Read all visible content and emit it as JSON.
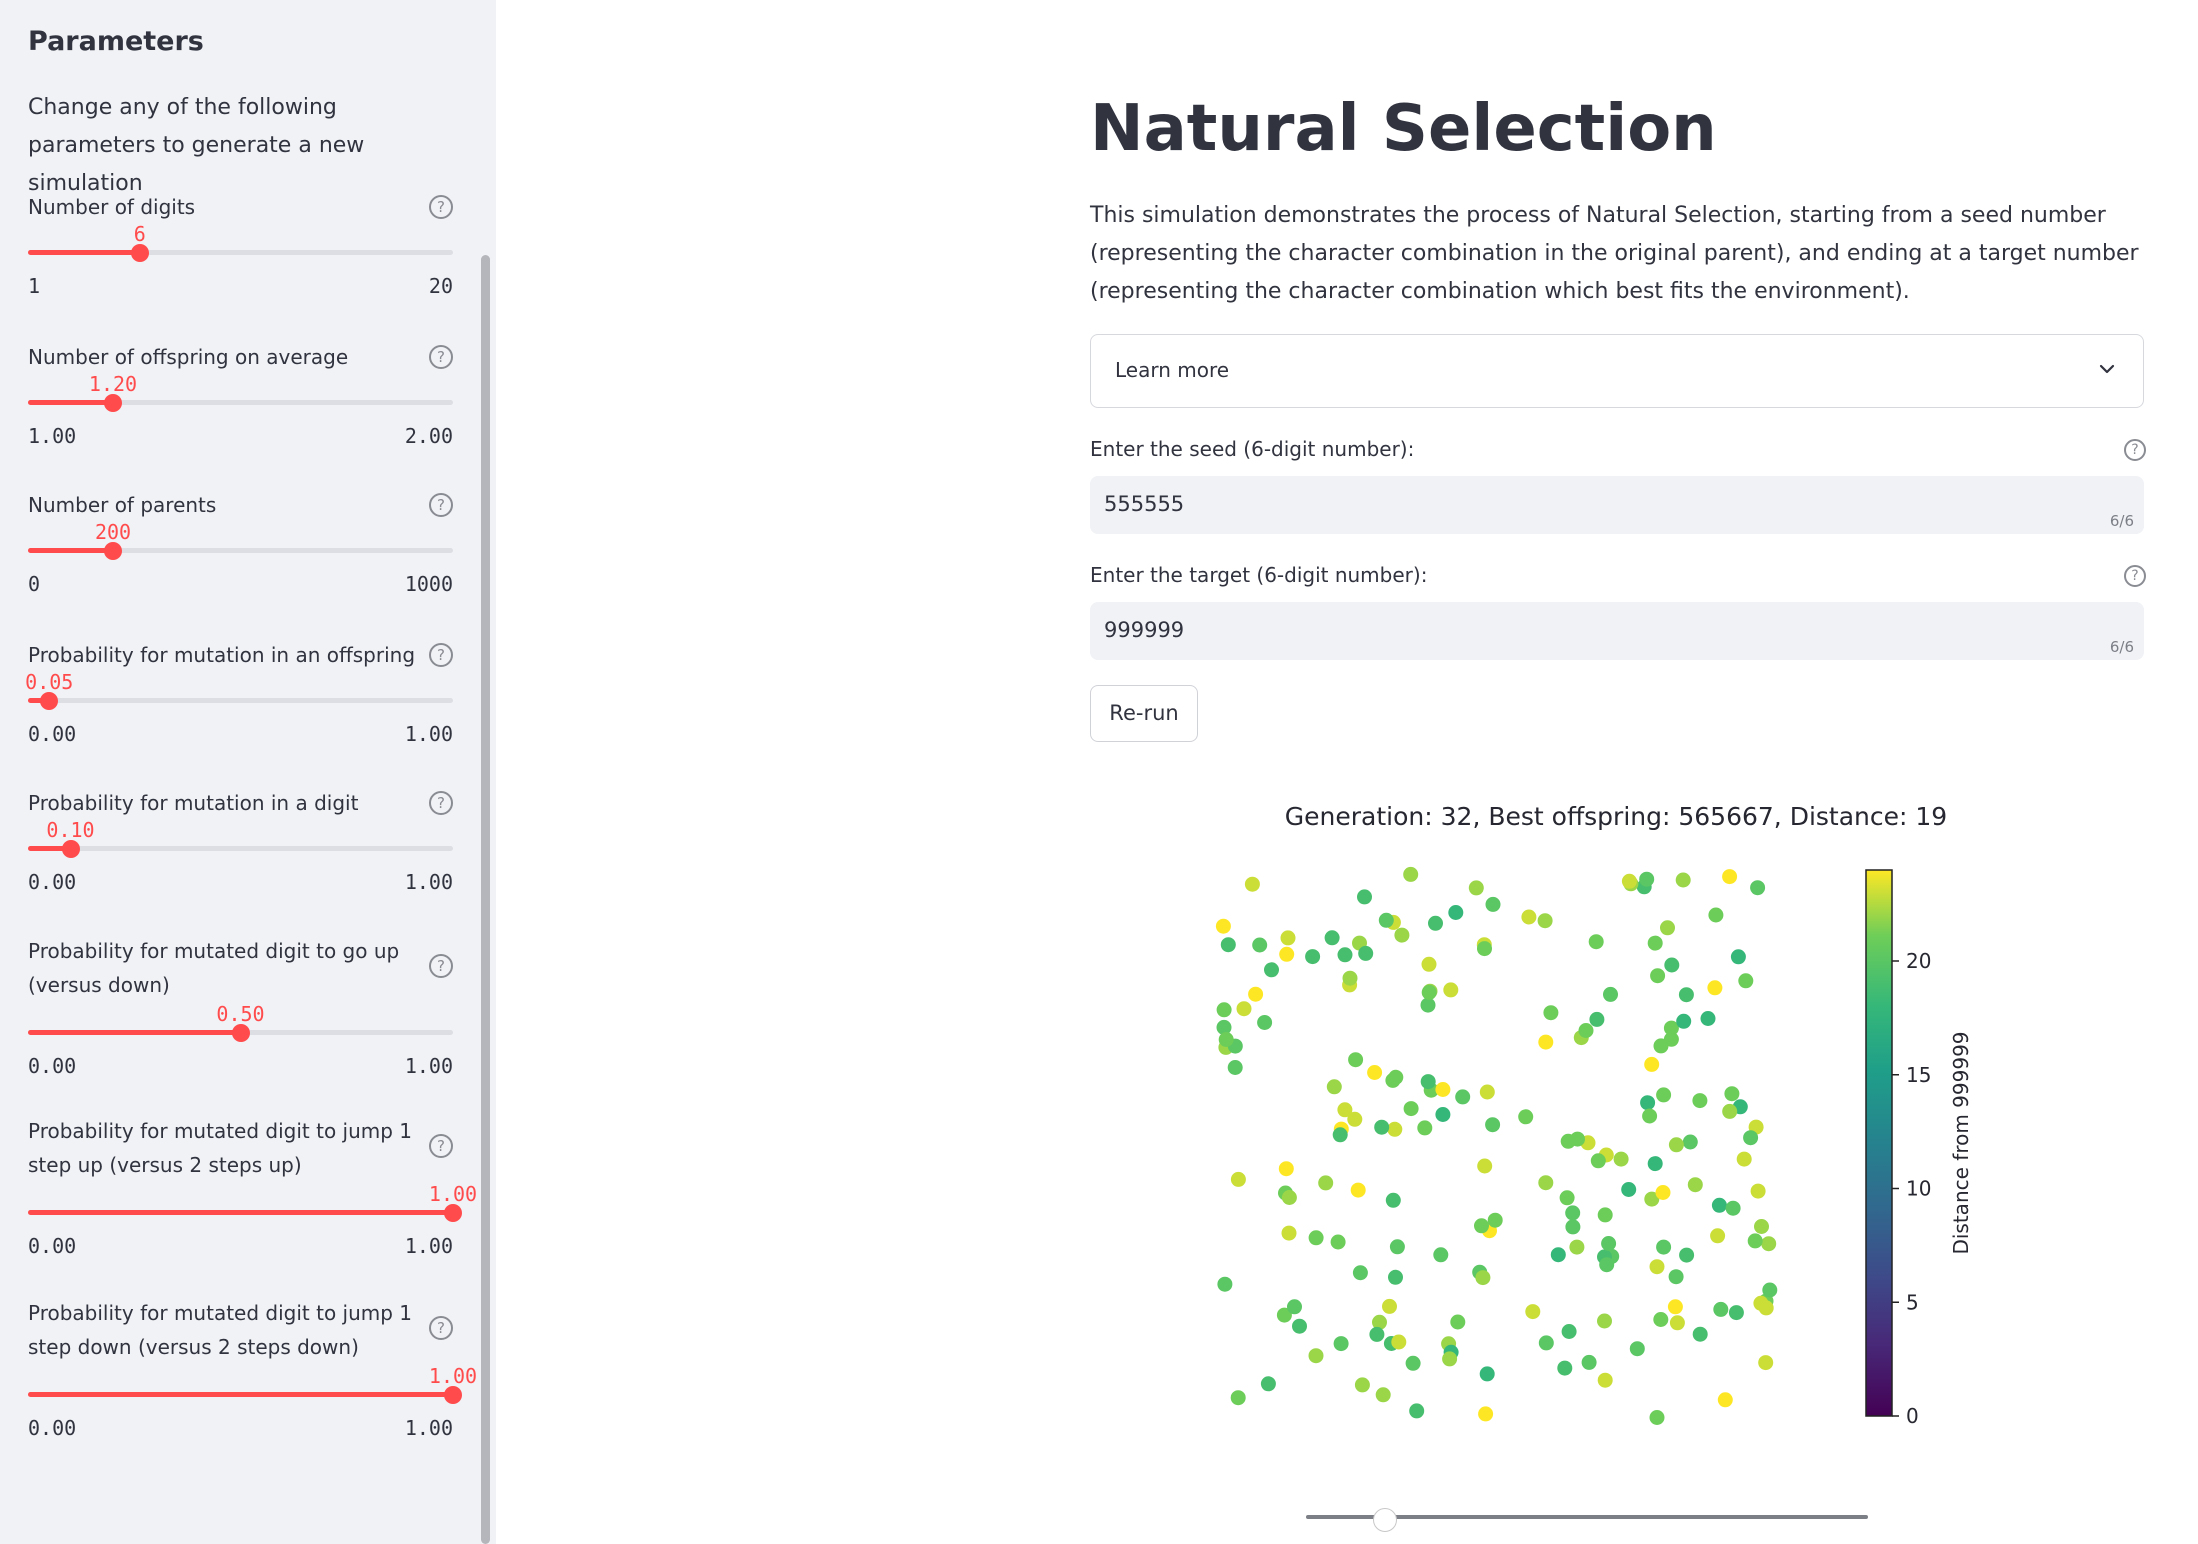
{
  "sidebar": {
    "title": "Parameters",
    "description": "Change any of the following parameters to generate a new simulation",
    "params": [
      {
        "label": "Number of digits",
        "value": "6",
        "min": "1",
        "max": "20",
        "fraction": 0.263
      },
      {
        "label": "Number of offspring on average",
        "value": "1.20",
        "min": "1.00",
        "max": "2.00",
        "fraction": 0.2
      },
      {
        "label": "Number of parents",
        "value": "200",
        "min": "0",
        "max": "1000",
        "fraction": 0.2
      },
      {
        "label": "Probability for mutation in an offspring",
        "value": "0.05",
        "min": "0.00",
        "max": "1.00",
        "fraction": 0.05
      },
      {
        "label": "Probability for mutation in a digit",
        "value": "0.10",
        "min": "0.00",
        "max": "1.00",
        "fraction": 0.1
      },
      {
        "label": "Probability for mutated digit to go up (versus down)",
        "value": "0.50",
        "min": "0.00",
        "max": "1.00",
        "fraction": 0.5
      },
      {
        "label": "Probability for mutated digit to jump 1 step up (versus 2 steps up)",
        "value": "1.00",
        "min": "0.00",
        "max": "1.00",
        "fraction": 1.0
      },
      {
        "label": "Probability for mutated digit to jump 1 step down (versus 2 steps down)",
        "value": "1.00",
        "min": "0.00",
        "max": "1.00",
        "fraction": 1.0
      }
    ],
    "help_glyph": "?"
  },
  "main": {
    "title": "Natural Selection",
    "intro": "This simulation demonstrates the process of Natural Selection, starting from a seed number (representing the character combination in the original parent), and ending at a target number (representing the character combination which best fits the environment).",
    "expander_label": "Learn more",
    "seed_label": "Enter the seed (6-digit number):",
    "seed_value": "555555",
    "seed_counter": "6/6",
    "target_label": "Enter the target (6-digit number):",
    "target_value": "999999",
    "target_counter": "6/6",
    "rerun_label": "Re-run",
    "generation_slider_fraction": 0.14
  },
  "colors": {
    "accent": "#ff4b4b",
    "sidebar_bg": "#f0f2f6",
    "text": "#31333f"
  },
  "chart_data": {
    "type": "scatter",
    "title": "Generation: 32, Best offspring: 565667, Distance: 19",
    "colorbar_label": "Distance from 999999",
    "colorbar_ticks": [
      0,
      5,
      10,
      15,
      20
    ],
    "colorbar_range": [
      0,
      24
    ],
    "colormap": "viridis",
    "axes_visible": false,
    "point_count": 200,
    "distance_range_observed": [
      18,
      24
    ]
  }
}
